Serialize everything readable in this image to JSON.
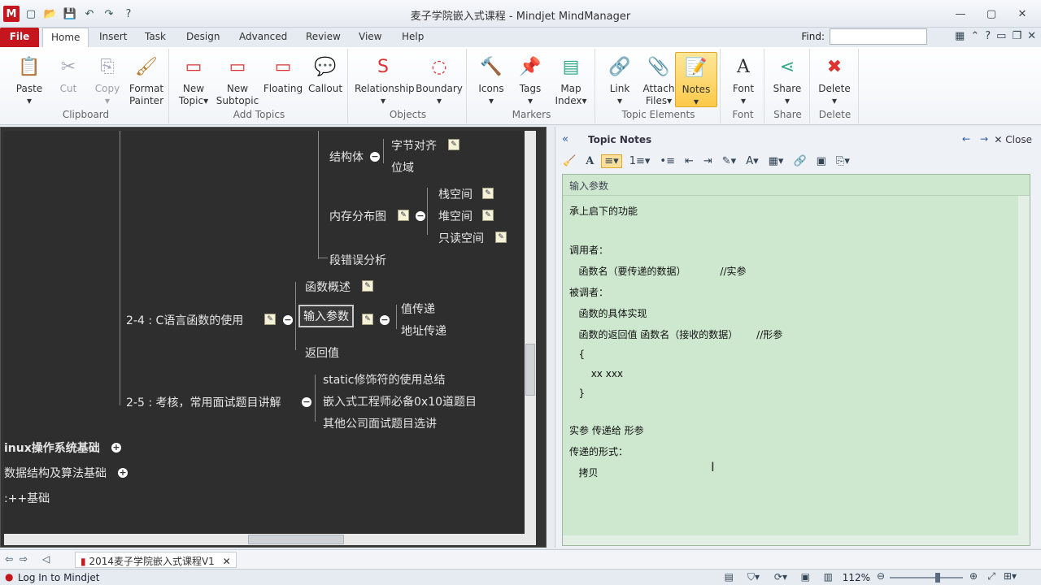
{
  "window": {
    "title": "麦子学院嵌入式课程 - Mindjet MindManager",
    "qat_icons": [
      "new-icon",
      "open-icon",
      "save-icon",
      "undo-icon",
      "redo-icon",
      "help-icon"
    ]
  },
  "tabs": {
    "file": "File",
    "items": [
      "Home",
      "Insert",
      "Task",
      "Design",
      "Advanced",
      "Review",
      "View",
      "Help"
    ],
    "active": "Home",
    "find_label": "Find:",
    "find_value": ""
  },
  "ribbon": {
    "groups": [
      {
        "label": "Clipboard",
        "buttons": [
          "Paste",
          "Cut",
          "Copy",
          "Format Painter"
        ]
      },
      {
        "label": "Add Topics",
        "buttons": [
          "New Topic",
          "New Subtopic",
          "Floating",
          "Callout"
        ]
      },
      {
        "label": "Objects",
        "buttons": [
          "Relationship",
          "Boundary"
        ]
      },
      {
        "label": "Markers",
        "buttons": [
          "Icons",
          "Tags",
          "Map Index"
        ]
      },
      {
        "label": "Topic Elements",
        "buttons": [
          "Link",
          "Attach Files",
          "Notes"
        ]
      },
      {
        "label": "Font",
        "buttons": [
          "Font"
        ]
      },
      {
        "label": "Share",
        "buttons": [
          "Share"
        ]
      },
      {
        "label": "Delete",
        "buttons": [
          "Delete"
        ]
      }
    ],
    "labels": {
      "paste": "Paste",
      "cut": "Cut",
      "copy": "Copy",
      "format1": "Format",
      "format2": "Painter",
      "new1": "New",
      "new2": "Topic",
      "newsub1": "New",
      "newsub2": "Subtopic",
      "floating": "Floating",
      "callout": "Callout",
      "relationship": "Relationship",
      "boundary": "Boundary",
      "icons": "Icons",
      "tags": "Tags",
      "map1": "Map",
      "map2": "Index",
      "link": "Link",
      "attach1": "Attach",
      "attach2": "Files",
      "notes": "Notes",
      "font": "Font",
      "share": "Share",
      "delete": "Delete"
    }
  },
  "map": {
    "topics": {
      "jiegouti": "结构体",
      "zijie": "字节对齐",
      "weiyu": "位域",
      "neicun": "内存分布图",
      "zhan": "栈空间",
      "dui": "堆空间",
      "zhidu": "只读空间",
      "duancuowu": "段错误分析",
      "hanshugaishu": "函数概述",
      "t24": "2-4 : C语言函数的使用",
      "shuru": "输入参数",
      "zhichuandi": "值传递",
      "dizhi": "地址传递",
      "fanhui": "返回值",
      "static": "static修饰符的使用总结",
      "t25": "2-5 : 考核，常用面试题目讲解",
      "qianru": "嵌入式工程师必备0x10道题目",
      "qita": "其他公司面试题目选讲",
      "linux": "inux操作系统基础",
      "shuju": "数据结构及算法基础",
      "cpp": ":++基础"
    }
  },
  "notes": {
    "pane_title": "Topic Notes",
    "close_label": "Close",
    "topic_name": "输入参数",
    "lines": [
      "承上启下的功能",
      "",
      "调用者：",
      "   函数名（要传递的数据）           //实参",
      "被调者：",
      "   函数的具体实现",
      "   函数的返回值 函数名（接收的数据）      //形参",
      "   {",
      "       xx xxx",
      "   }",
      "",
      "实参 传递给 形参",
      "传递的形式：",
      "   拷贝"
    ]
  },
  "doctab": "2014麦子学院嵌入式课程V1",
  "status": {
    "login": "Log In to Mindjet",
    "zoom": "112%"
  }
}
